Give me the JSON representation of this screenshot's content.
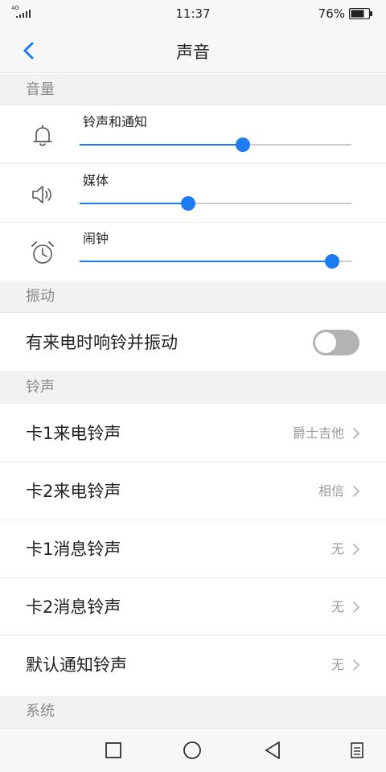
{
  "status_bar": {
    "network": "4G",
    "time": "11:37",
    "battery": "76%",
    "battery_level": 0.76
  },
  "header": {
    "title": "声音",
    "back_icon": "chevron-left-icon"
  },
  "sections": {
    "volume": "音量",
    "vibrate": "振动",
    "ringtone": "铃声",
    "system": "系统"
  },
  "volume": {
    "items": [
      {
        "label": "铃声和通知",
        "icon": "bell-icon",
        "level": 0.6
      },
      {
        "label": "媒体",
        "icon": "speaker-icon",
        "level": 0.4
      },
      {
        "label": "闹钟",
        "icon": "alarm-clock-icon",
        "level": 0.93
      }
    ]
  },
  "vibrate": {
    "label": "有来电时响铃并振动",
    "enabled": false
  },
  "ringtones": {
    "items": [
      {
        "label": "卡1来电铃声",
        "value": "爵士吉他"
      },
      {
        "label": "卡2来电铃声",
        "value": "相信"
      },
      {
        "label": "卡1消息铃声",
        "value": "无"
      },
      {
        "label": "卡2消息铃声",
        "value": "无"
      },
      {
        "label": "默认通知铃声",
        "value": "无"
      }
    ]
  },
  "colors": {
    "accent": "#1d7cf2",
    "toggle_off": "#b3b3b3",
    "section_bg": "#f2f2f2"
  }
}
